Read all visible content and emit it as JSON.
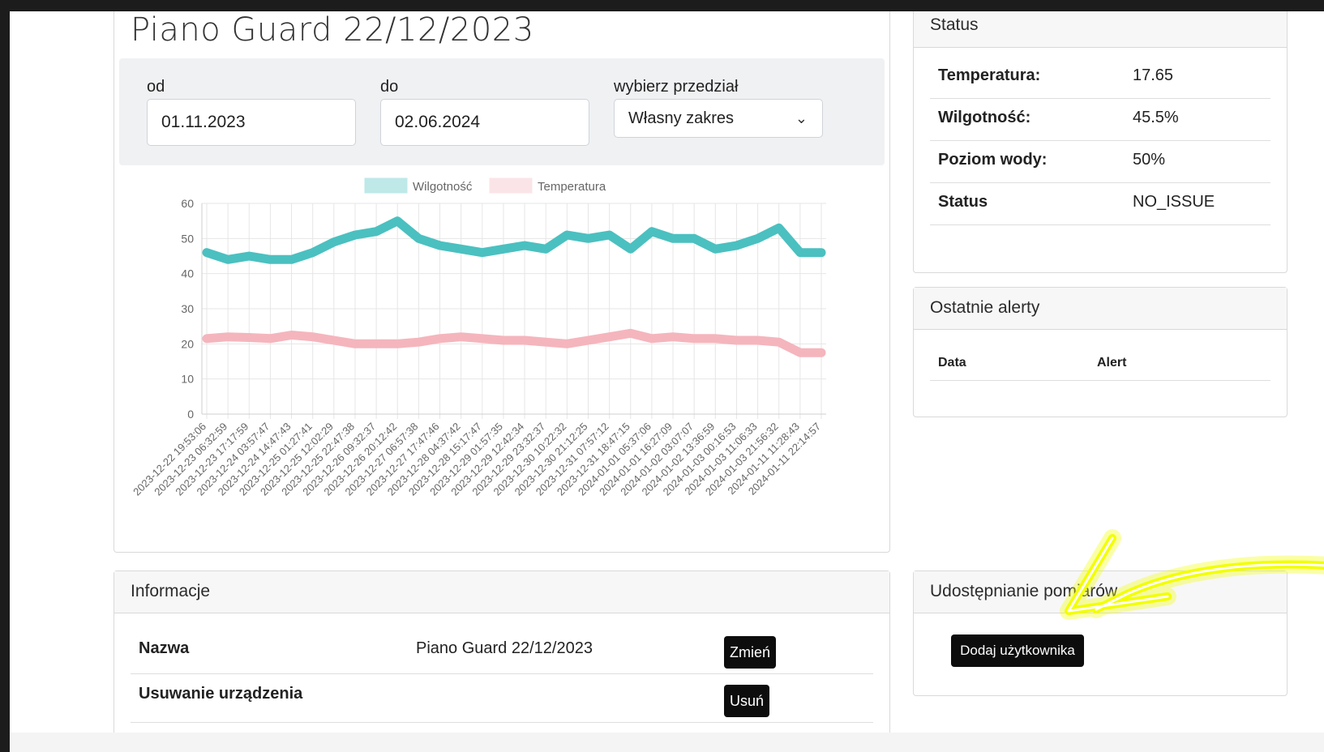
{
  "device": {
    "title": "Piano Guard 22/12/2023"
  },
  "filters": {
    "from_label": "od",
    "from_value": "01.11.2023",
    "to_label": "do",
    "to_value": "02.06.2024",
    "range_label": "wybierz przedział",
    "range_value": "Własny zakres"
  },
  "chart_data": {
    "type": "line",
    "x": [
      "2023-12-22 19:53:06",
      "2023-12-23 06:32:59",
      "2023-12-23 17:17:59",
      "2023-12-24 03:57:47",
      "2023-12-24 14:47:43",
      "2023-12-25 01:27:41",
      "2023-12-25 12:02:29",
      "2023-12-25 22:47:38",
      "2023-12-26 09:32:37",
      "2023-12-26 20:12:42",
      "2023-12-27 06:57:38",
      "2023-12-27 17:47:46",
      "2023-12-28 04:37:42",
      "2023-12-28 15:17:47",
      "2023-12-29 01:57:35",
      "2023-12-29 12:42:34",
      "2023-12-29 23:32:37",
      "2023-12-30 10:22:32",
      "2023-12-30 21:12:25",
      "2023-12-31 07:57:12",
      "2023-12-31 18:47:15",
      "2024-01-01 05:37:06",
      "2024-01-01 16:27:09",
      "2024-01-02 03:07:07",
      "2024-01-02 13:36:59",
      "2024-01-03 00:16:53",
      "2024-01-03 11:06:33",
      "2024-01-03 21:56:32",
      "2024-01-11 11:28:43",
      "2024-01-11 22:14:57"
    ],
    "series": [
      {
        "name": "Wilgotność",
        "color": "#4bc0c0",
        "values": [
          46,
          44,
          45,
          44,
          44,
          46,
          49,
          51,
          52,
          55,
          50,
          48,
          47,
          46,
          47,
          48,
          47,
          51,
          50,
          51,
          47,
          52,
          50,
          50,
          47,
          48,
          50,
          53,
          46,
          46
        ]
      },
      {
        "name": "Temperatura",
        "color": "#f5b5bd",
        "values": [
          21.5,
          22,
          21.8,
          21.5,
          22.5,
          22,
          21,
          20,
          20,
          20,
          20.5,
          21.5,
          22,
          21.5,
          21,
          21,
          20.5,
          20,
          21,
          22,
          23,
          21.5,
          22,
          21.5,
          21.5,
          21,
          21,
          20.5,
          17.5,
          17.5
        ]
      }
    ],
    "ylim": [
      0,
      60
    ],
    "yticks": [
      "60",
      "50",
      "40",
      "30",
      "20",
      "10",
      "0"
    ],
    "legend_position": "top",
    "grid": true
  },
  "status": {
    "header": "Status",
    "rows": [
      {
        "label": "Temperatura:",
        "value": "17.65"
      },
      {
        "label": "Wilgotność:",
        "value": "45.5%"
      },
      {
        "label": "Poziom wody:",
        "value": "50%"
      },
      {
        "label": "Status",
        "value": "NO_ISSUE"
      }
    ]
  },
  "alerts": {
    "header": "Ostatnie alerty",
    "col_date": "Data",
    "col_alert": "Alert"
  },
  "info": {
    "header": "Informacje",
    "name_label": "Nazwa",
    "name_value": "Piano Guard 22/12/2023",
    "change_button": "Zmień",
    "remove_label": "Usuwanie urządzenia",
    "remove_button": "Usuń"
  },
  "sharing": {
    "header": "Udostępnianie pomiarów",
    "add_user_button": "Dodaj użytkownika"
  },
  "highlight": {
    "arrow_color": "#f2ff00"
  }
}
